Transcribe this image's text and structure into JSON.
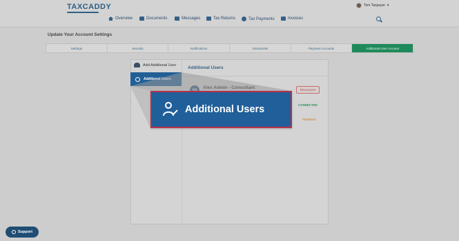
{
  "brand": {
    "logo_text": "TAXCADDY"
  },
  "user_menu": {
    "name": "Tom Taxpayer",
    "chevron": "▾",
    "avatar_icon": "avatar-photo"
  },
  "nav": {
    "items": [
      {
        "label": "Overview",
        "icon": "home-icon"
      },
      {
        "label": "Documents",
        "icon": "documents-icon"
      },
      {
        "label": "Messages",
        "icon": "messages-icon"
      },
      {
        "label": "Tax Returns",
        "icon": "tax-returns-icon"
      },
      {
        "label": "Tax Payments",
        "icon": "tax-payments-icon"
      },
      {
        "label": "Invoices",
        "icon": "invoices-icon"
      }
    ],
    "search_icon": "search-icon"
  },
  "page": {
    "title": "Update Your Account Settings"
  },
  "tabs": [
    "Settings",
    "Security",
    "Notifications",
    "SmartLinks",
    "Payment Accounts",
    "Additional User Account"
  ],
  "sidebar": {
    "add_label": "Add Additional User",
    "active_label": "Additional Users"
  },
  "content": {
    "title": "Additional Users",
    "entry_name": "Alex Admin - Consultant",
    "entry_initials": "AA",
    "disconnect_label": "Disconnect",
    "status_connected": "CONNECTED",
    "status_pending": "PENDING"
  },
  "callout": {
    "label": "Additional Users",
    "icon": "user-check-icon"
  },
  "support": {
    "label": "Support",
    "icon": "support-icon"
  },
  "colors": {
    "brand_blue": "#215f96",
    "accent_green": "#1e8a5b",
    "highlight_red": "#b72f47",
    "connected_green": "#2b8f56",
    "pending_orange": "#c67c2a"
  }
}
